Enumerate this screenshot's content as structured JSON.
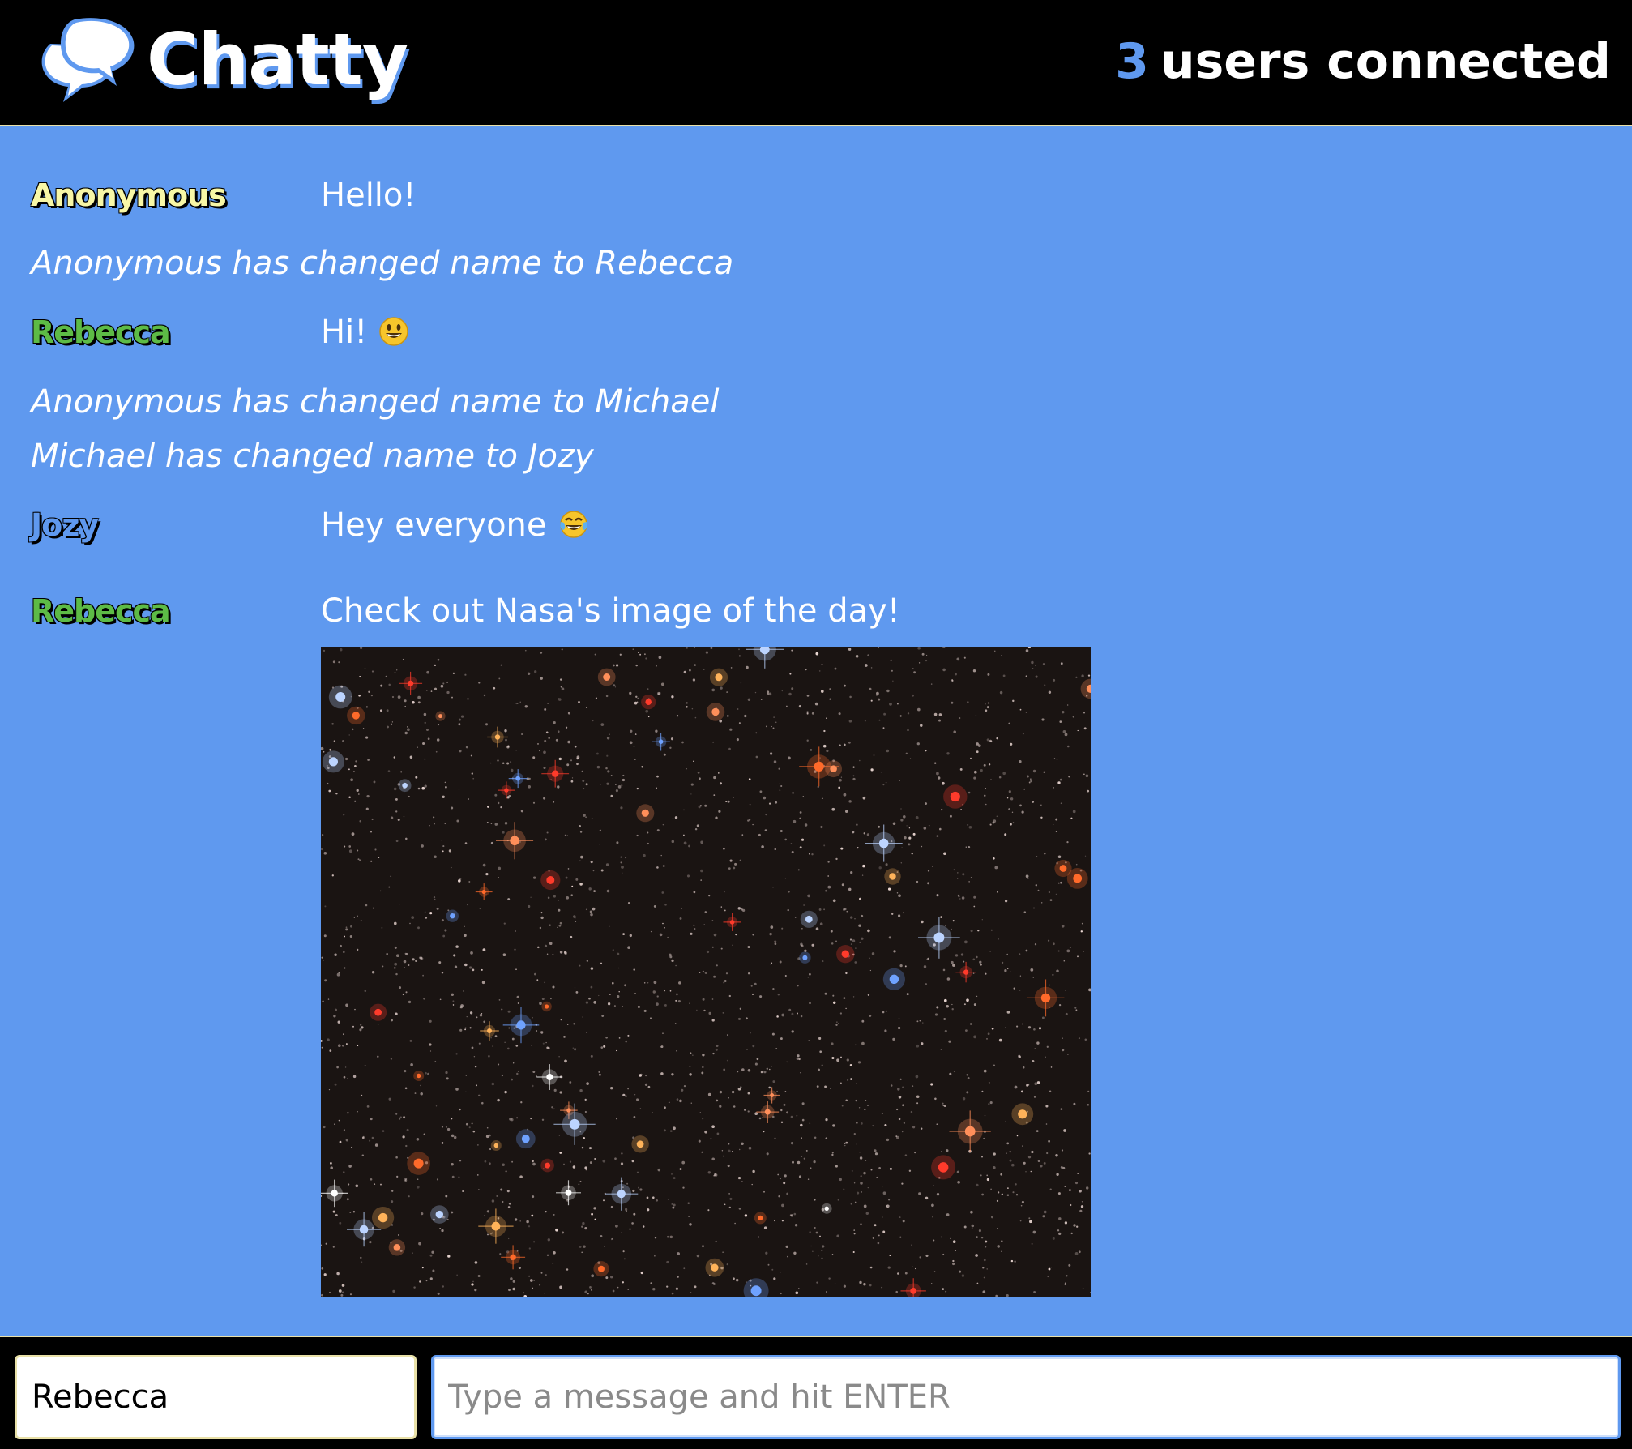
{
  "navbar": {
    "brand": "Chatty",
    "user_count": "3",
    "user_count_label": "users connected"
  },
  "colors": {
    "background": "#5f99ef",
    "navbar": "#000000",
    "accent": "#5f99ef",
    "border": "#e9e1a8",
    "user_anonymous": "#f8f7a6",
    "user_rebecca": "#5dbb46",
    "user_jozy": "#5f99ef"
  },
  "messages": [
    {
      "type": "message",
      "username": "Anonymous",
      "content": "Hello!"
    },
    {
      "type": "notification",
      "content": "Anonymous has changed name to Rebecca"
    },
    {
      "type": "message",
      "username": "Rebecca",
      "content": "Hi!",
      "emoji": "smiley-emoji"
    },
    {
      "type": "notification",
      "content": "Anonymous has changed name to Michael"
    },
    {
      "type": "notification",
      "content": "Michael has changed name to Jozy"
    },
    {
      "type": "message",
      "username": "Jozy",
      "content": "Hey everyone",
      "emoji": "tears-of-joy-emoji"
    },
    {
      "type": "message",
      "username": "Rebecca",
      "content": "Check out Nasa's image of the day!",
      "image": "star-cluster-image"
    }
  ],
  "chatbar": {
    "name_value": "Rebecca",
    "message_placeholder": "Type a message and hit ENTER"
  }
}
